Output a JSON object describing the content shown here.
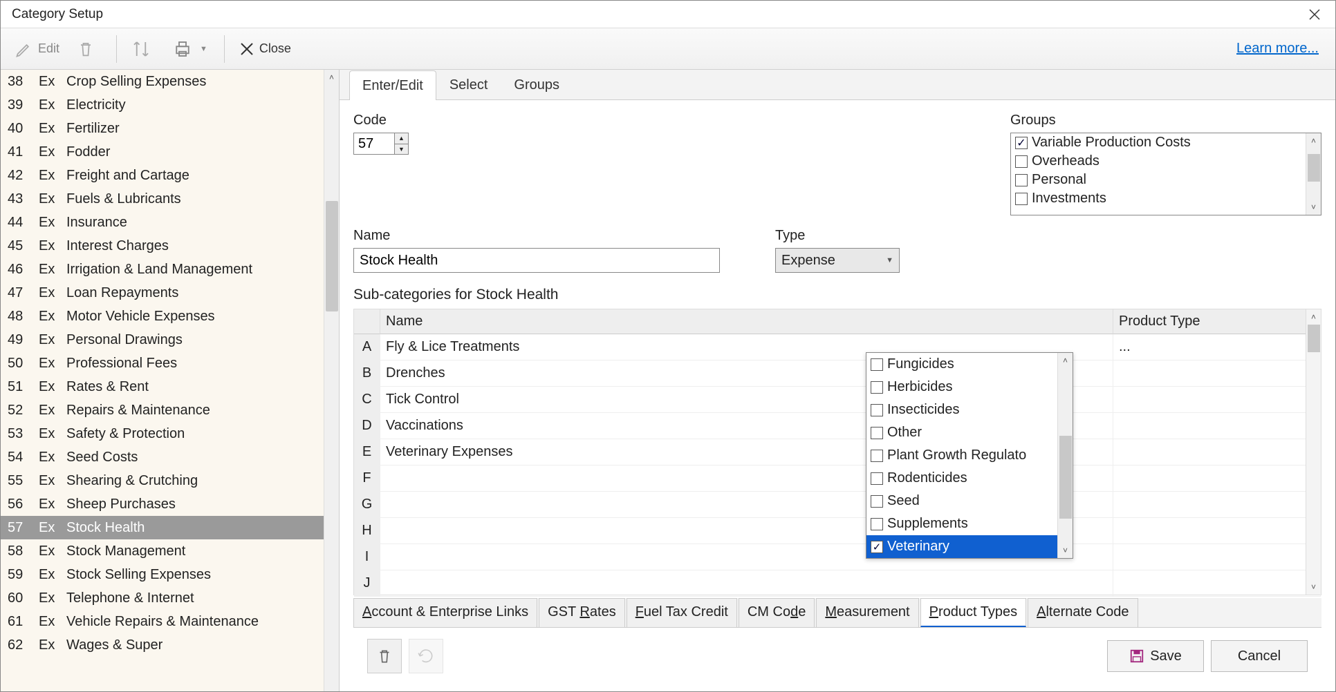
{
  "window": {
    "title": "Category Setup"
  },
  "toolbar": {
    "edit": "Edit",
    "close": "Close",
    "learn_more": "Learn more..."
  },
  "sidebar": {
    "items": [
      {
        "code": "38",
        "type": "Ex",
        "name": "Crop Selling Expenses"
      },
      {
        "code": "39",
        "type": "Ex",
        "name": "Electricity"
      },
      {
        "code": "40",
        "type": "Ex",
        "name": "Fertilizer"
      },
      {
        "code": "41",
        "type": "Ex",
        "name": "Fodder"
      },
      {
        "code": "42",
        "type": "Ex",
        "name": "Freight and Cartage"
      },
      {
        "code": "43",
        "type": "Ex",
        "name": "Fuels & Lubricants"
      },
      {
        "code": "44",
        "type": "Ex",
        "name": "Insurance"
      },
      {
        "code": "45",
        "type": "Ex",
        "name": "Interest Charges"
      },
      {
        "code": "46",
        "type": "Ex",
        "name": "Irrigation & Land Management"
      },
      {
        "code": "47",
        "type": "Ex",
        "name": "Loan Repayments"
      },
      {
        "code": "48",
        "type": "Ex",
        "name": "Motor Vehicle Expenses"
      },
      {
        "code": "49",
        "type": "Ex",
        "name": "Personal Drawings"
      },
      {
        "code": "50",
        "type": "Ex",
        "name": "Professional Fees"
      },
      {
        "code": "51",
        "type": "Ex",
        "name": "Rates & Rent"
      },
      {
        "code": "52",
        "type": "Ex",
        "name": "Repairs & Maintenance"
      },
      {
        "code": "53",
        "type": "Ex",
        "name": "Safety & Protection"
      },
      {
        "code": "54",
        "type": "Ex",
        "name": "Seed Costs"
      },
      {
        "code": "55",
        "type": "Ex",
        "name": "Shearing & Crutching"
      },
      {
        "code": "56",
        "type": "Ex",
        "name": "Sheep Purchases"
      },
      {
        "code": "57",
        "type": "Ex",
        "name": "Stock Health",
        "selected": true
      },
      {
        "code": "58",
        "type": "Ex",
        "name": "Stock Management"
      },
      {
        "code": "59",
        "type": "Ex",
        "name": "Stock Selling Expenses"
      },
      {
        "code": "60",
        "type": "Ex",
        "name": "Telephone & Internet"
      },
      {
        "code": "61",
        "type": "Ex",
        "name": "Vehicle Repairs & Maintenance"
      },
      {
        "code": "62",
        "type": "Ex",
        "name": "Wages & Super"
      }
    ]
  },
  "tabs_top": [
    "Enter/Edit",
    "Select",
    "Groups"
  ],
  "form": {
    "code_label": "Code",
    "code_value": "57",
    "name_label": "Name",
    "name_value": "Stock Health",
    "type_label": "Type",
    "type_value": "Expense",
    "groups_label": "Groups",
    "groups": [
      {
        "label": "Variable Production Costs",
        "checked": true
      },
      {
        "label": "Overheads",
        "checked": false
      },
      {
        "label": "Personal",
        "checked": false
      },
      {
        "label": "Investments",
        "checked": false
      }
    ],
    "sub_label": "Sub-categories for Stock Health"
  },
  "subcat": {
    "headers": {
      "name": "Name",
      "product_type": "Product Type"
    },
    "rows": [
      {
        "letter": "A",
        "name": "Fly & Lice Treatments",
        "pt": "..."
      },
      {
        "letter": "B",
        "name": "Drenches",
        "pt": ""
      },
      {
        "letter": "C",
        "name": "Tick Control",
        "pt": ""
      },
      {
        "letter": "D",
        "name": "Vaccinations",
        "pt": ""
      },
      {
        "letter": "E",
        "name": "Veterinary Expenses",
        "pt": ""
      },
      {
        "letter": "F",
        "name": "",
        "pt": ""
      },
      {
        "letter": "G",
        "name": "",
        "pt": ""
      },
      {
        "letter": "H",
        "name": "",
        "pt": ""
      },
      {
        "letter": "I",
        "name": "",
        "pt": ""
      },
      {
        "letter": "J",
        "name": "",
        "pt": ""
      }
    ]
  },
  "product_types": [
    {
      "label": "Fungicides",
      "checked": false
    },
    {
      "label": "Herbicides",
      "checked": false
    },
    {
      "label": "Insecticides",
      "checked": false
    },
    {
      "label": "Other",
      "checked": false
    },
    {
      "label": "Plant Growth Regulato",
      "checked": false
    },
    {
      "label": "Rodenticides",
      "checked": false
    },
    {
      "label": "Seed",
      "checked": false
    },
    {
      "label": "Supplements",
      "checked": false
    },
    {
      "label": "Veterinary",
      "checked": true,
      "selected": true
    }
  ],
  "bottom_tabs": [
    {
      "pre": "",
      "u": "A",
      "post": "ccount & Enterprise Links"
    },
    {
      "pre": "GST ",
      "u": "R",
      "post": "ates"
    },
    {
      "pre": "",
      "u": "F",
      "post": "uel Tax Credit"
    },
    {
      "pre": "CM Co",
      "u": "d",
      "post": "e"
    },
    {
      "pre": "",
      "u": "M",
      "post": "easurement"
    },
    {
      "pre": "",
      "u": "P",
      "post": "roduct Types",
      "active": true
    },
    {
      "pre": "",
      "u": "A",
      "post": "lternate Code"
    }
  ],
  "footer": {
    "save": "Save",
    "cancel": "Cancel"
  }
}
